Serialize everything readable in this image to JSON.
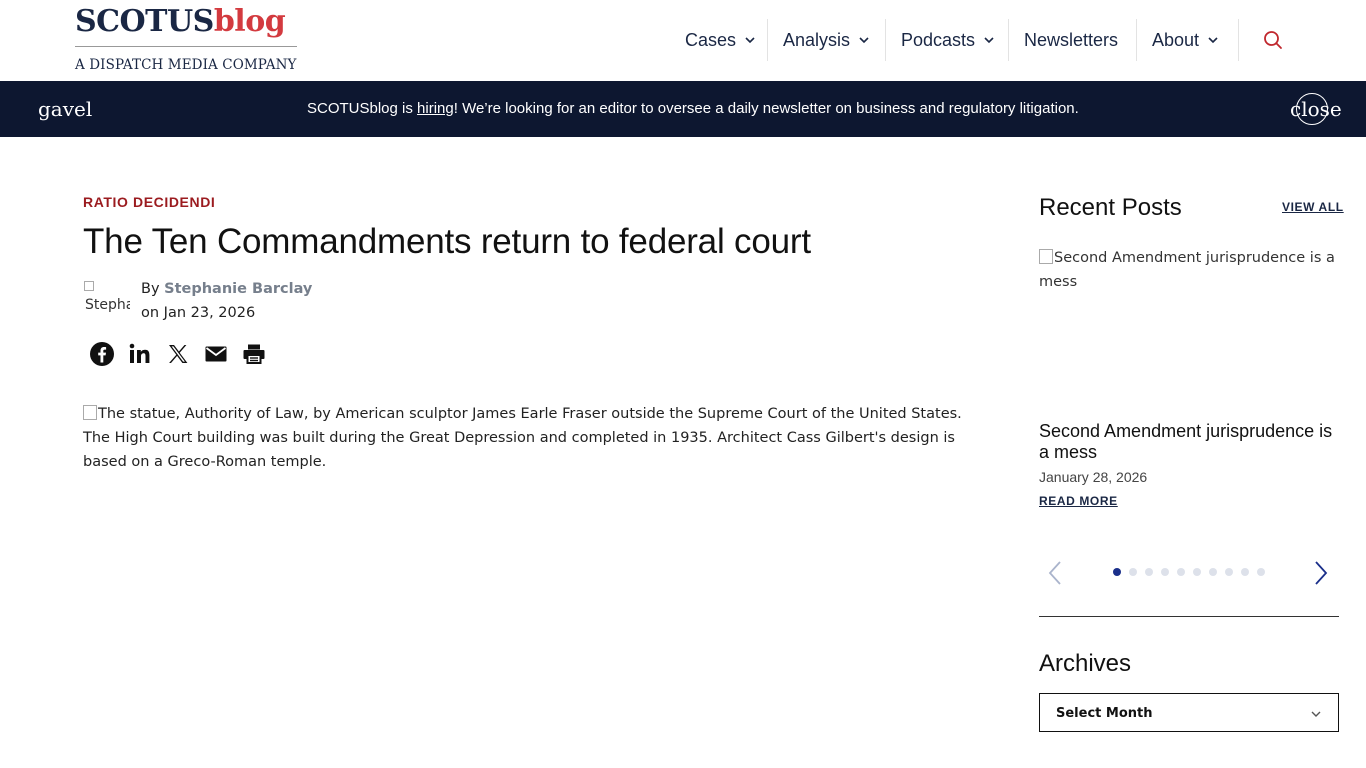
{
  "logo": {
    "part1": "SCOTUS",
    "part2": "blog",
    "tagline": "A DISPATCH MEDIA COMPANY",
    "colors": {
      "navy": "#1a2744",
      "red": "#d33a3f"
    }
  },
  "nav": {
    "items": [
      {
        "label": "Cases"
      },
      {
        "label": "Analysis"
      },
      {
        "label": "Podcasts"
      },
      {
        "label": "Newsletters"
      },
      {
        "label": "About"
      }
    ],
    "search_icon": "search-icon"
  },
  "banner": {
    "icon_text": "gavel",
    "text_before": "SCOTUSblog is ",
    "link": "hiring",
    "text_after": "! We’re looking for an editor to oversee a daily newsletter on business and regulatory litigation.",
    "close_text": "close",
    "background": "#0d1730"
  },
  "article": {
    "kicker": "RATIO DECIDENDI",
    "title": "The Ten Commandments return to federal court",
    "avatar_alt": "Stepha",
    "by_prefix": "By ",
    "author": "Stephanie Barclay",
    "date_prefix": "on ",
    "date": "Jan 23, 2026",
    "share": [
      "facebook-icon",
      "linkedin-icon",
      "x-icon",
      "email-icon",
      "print-icon"
    ],
    "hero_alt": "The statue, Authority of Law, by American sculptor James Earle Fraser outside the Supreme Court of the United States. The High Court building was built during the Great Depression and completed in 1935. Architect Cass Gilbert's design is based on a Greco-Roman temple."
  },
  "sidebar": {
    "recent_title": "Recent Posts",
    "view_all": "VIEW ALL",
    "post": {
      "image_alt": "Second Amendment jurisprudence is a mess",
      "title": "Second Amendment jurisprudence is a mess",
      "date": "January 28, 2026",
      "read_more": "READ MORE"
    },
    "carousel": {
      "total": 10,
      "active_index": 0
    },
    "archives_title": "Archives",
    "archives_select": "Select Month"
  }
}
